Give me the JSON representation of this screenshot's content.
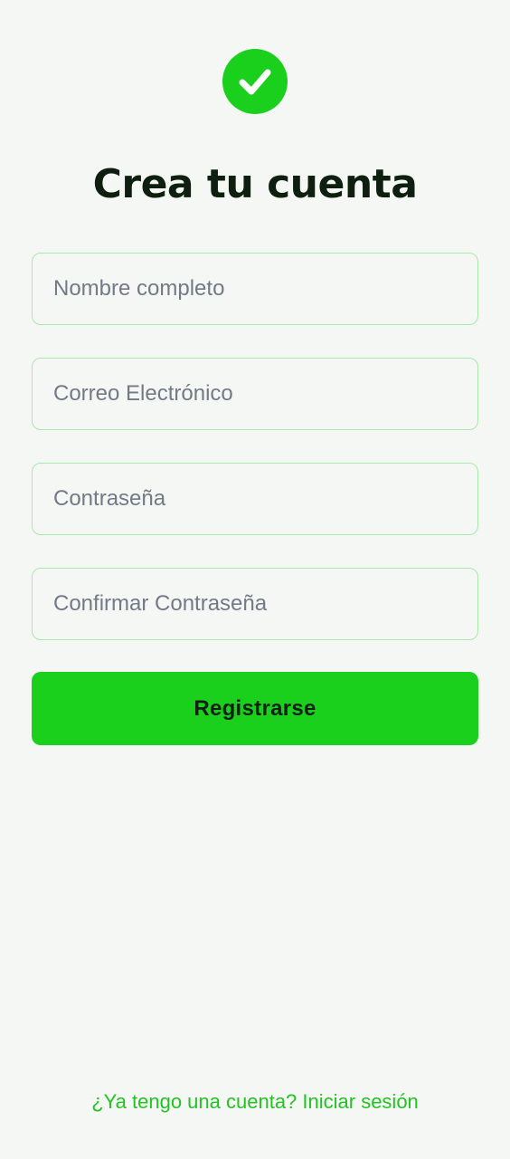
{
  "app": {
    "logo_icon": "checkmark-circle-icon",
    "accent_color": "#1ad01d"
  },
  "header": {
    "title": "Crea tu cuenta"
  },
  "form": {
    "full_name": {
      "value": "",
      "placeholder": "Nombre completo"
    },
    "email": {
      "value": "",
      "placeholder": "Correo Electrónico"
    },
    "password": {
      "value": "",
      "placeholder": "Contraseña"
    },
    "confirm_password": {
      "value": "",
      "placeholder": "Confirmar Contraseña"
    },
    "submit_label": "Registrarse"
  },
  "footer": {
    "login_link": "¿Ya tengo una cuenta? Iniciar sesión"
  }
}
